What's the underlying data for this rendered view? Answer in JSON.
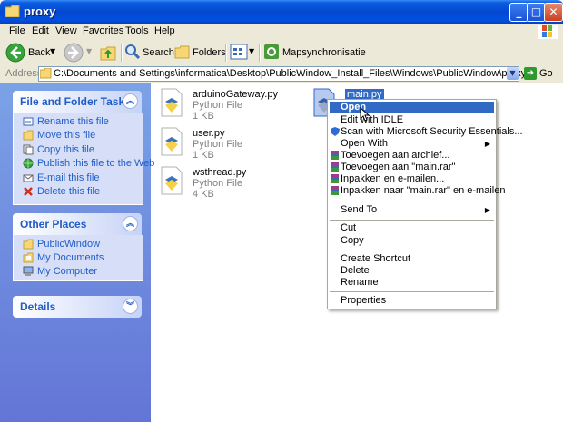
{
  "window": {
    "title": "proxy"
  },
  "menubar": [
    "File",
    "Edit",
    "View",
    "Favorites",
    "Tools",
    "Help"
  ],
  "toolbar": {
    "back": "Back",
    "search": "Search",
    "folders": "Folders",
    "sync": "Mapsynchronisatie"
  },
  "address": {
    "label": "Address",
    "path": "C:\\Documents and Settings\\informatica\\Desktop\\PublicWindow_Install_Files\\Windows\\PublicWindow\\proxy",
    "go": "Go"
  },
  "tasks": {
    "file_folder": {
      "title": "File and Folder Tasks",
      "items": [
        "Rename this file",
        "Move this file",
        "Copy this file",
        "Publish this file to the Web",
        "E-mail this file",
        "Delete this file"
      ]
    },
    "other_places": {
      "title": "Other Places",
      "items": [
        "PublicWindow",
        "My Documents",
        "My Computer"
      ]
    },
    "details": {
      "title": "Details"
    }
  },
  "files": [
    {
      "name": "arduinoGateway.py",
      "type": "Python File",
      "size": "1 KB"
    },
    {
      "name": "main.py",
      "type": "",
      "size": ""
    },
    {
      "name": "user.py",
      "type": "Python File",
      "size": "1 KB"
    },
    {
      "name": "wsthread.py",
      "type": "Python File",
      "size": "4 KB"
    }
  ],
  "context_menu": {
    "items": [
      "Open",
      "Edit with IDLE",
      "Scan with Microsoft Security Essentials...",
      "Open With",
      "Toevoegen aan archief...",
      "Toevoegen aan \"main.rar\"",
      "Inpakken en e-mailen...",
      "Inpakken naar \"main.rar\" en e-mailen",
      "Send To",
      "Cut",
      "Copy",
      "Create Shortcut",
      "Delete",
      "Rename",
      "Properties"
    ]
  },
  "colors": {
    "titlebar": "#0548d0",
    "selection": "#316ac5",
    "task_link": "#215dc6"
  }
}
